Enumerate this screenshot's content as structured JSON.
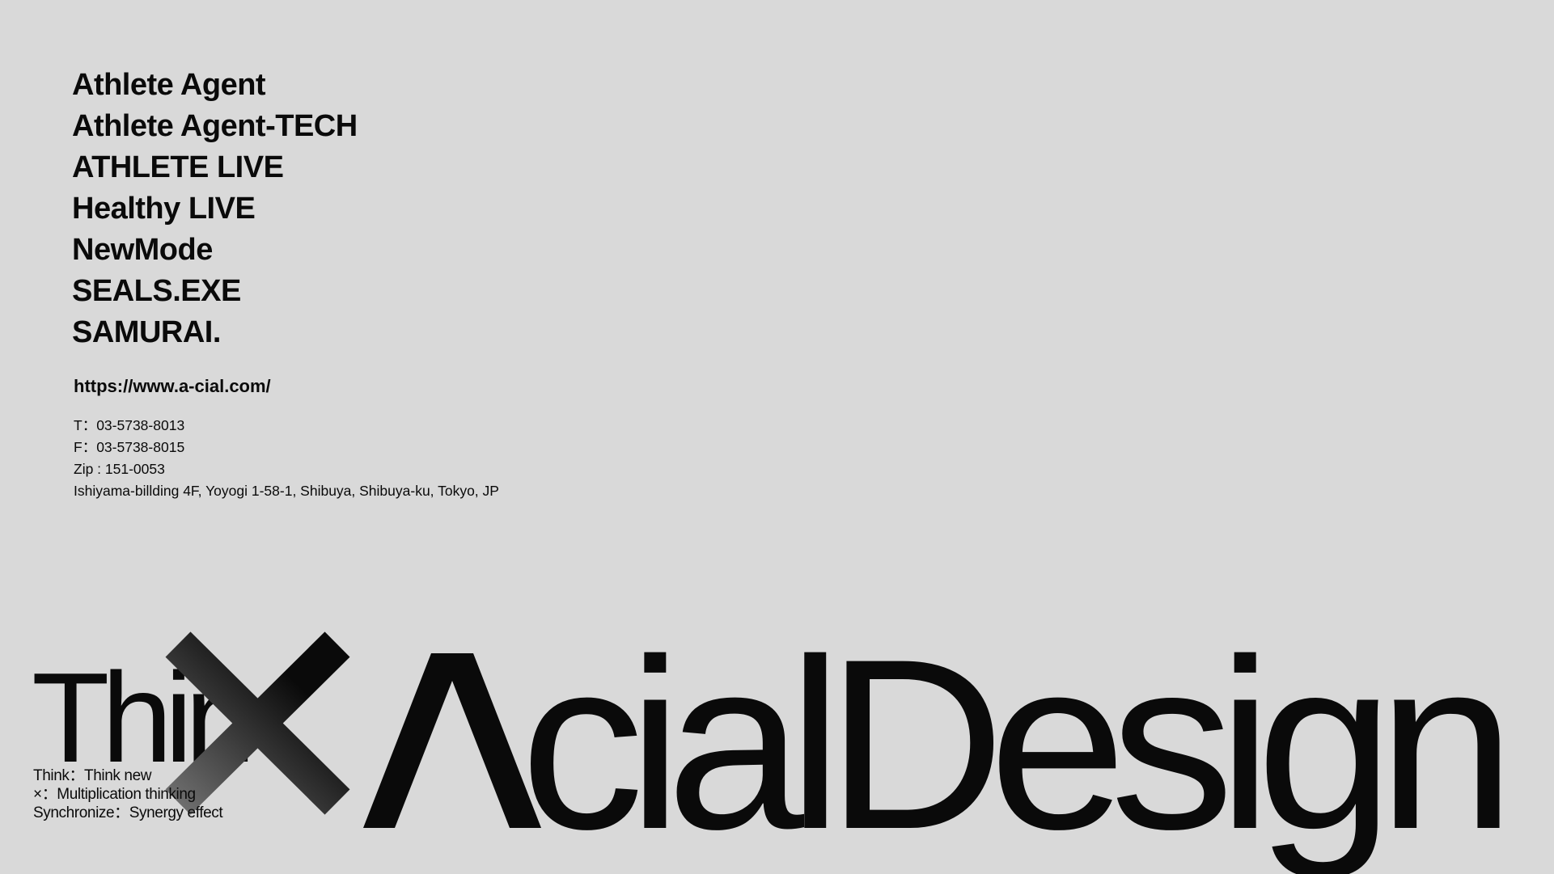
{
  "brands": [
    "Athlete Agent",
    "Athlete Agent-TECH",
    "ATHLETE LIVE",
    "Healthy LIVE",
    "NewMode",
    "SEALS.EXE",
    "SAMURAI."
  ],
  "site_url": "https://www.a-cial.com/",
  "contact": {
    "tel": "T：03-5738-8013",
    "fax": "F：03-5738-8015",
    "zip": "Zip : 151-0053",
    "address": "Ishiyama-billding 4F,  Yoyogi 1-58-1, Shibuya, Shibuya-ku, Tokyo, JP"
  },
  "wordmark": {
    "think": "Thin",
    "company": "cialDesign"
  },
  "think_captions": [
    "Think：Think new",
    "×：Multiplication thinking",
    "Synchronize：Synergy effect"
  ],
  "colors": {
    "background": "#d9d9d9",
    "text": "#0a0a0a",
    "x_mark_light": "#6e6e6e",
    "x_mark_dark": "#0a0a0a"
  },
  "icons": {
    "x_mark": "multiplication-x-mark-icon",
    "a_mark": "lambda-a-icon"
  }
}
